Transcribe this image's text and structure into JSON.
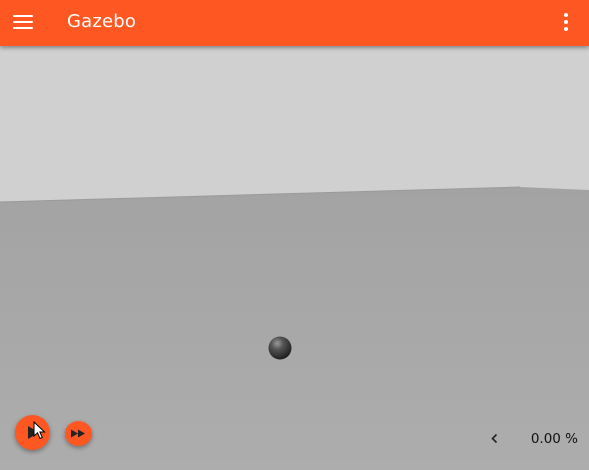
{
  "app_bar": {
    "title": "Gazebo",
    "menu_icon": "hamburger-menu-icon",
    "overflow_icon": "more-vertical-icon",
    "color": "#ff5722"
  },
  "scene": {
    "sky_color": "#d0d0d0",
    "ground_color": "#a9a9a9",
    "objects": [
      {
        "type": "sphere",
        "color": "#3a3a3a"
      }
    ]
  },
  "controls": {
    "play_icon": "play-icon",
    "step_icon": "fast-forward-icon",
    "collapse_icon": "chevron-left-icon",
    "real_time_factor": "0.00 %"
  }
}
